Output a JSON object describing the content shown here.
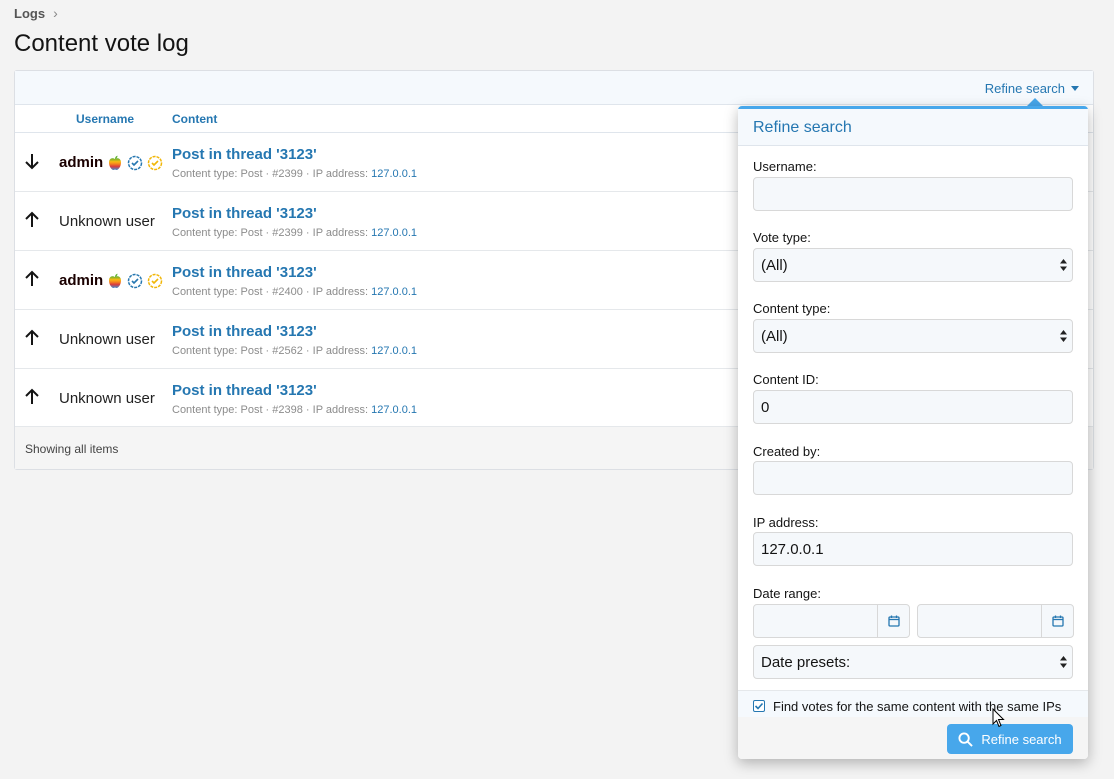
{
  "breadcrumb": {
    "item": "Logs"
  },
  "page": {
    "title": "Content vote log"
  },
  "filterbar": {
    "refine_label": "Refine search"
  },
  "table": {
    "headers": {
      "username": "Username",
      "content": "Content"
    },
    "rows": [
      {
        "vote": "down",
        "username": "admin",
        "user_type": "admin",
        "title": "Post in thread '3123'",
        "meta": "Content type: Post · #2399 · IP address: ",
        "ip": "127.0.0.1"
      },
      {
        "vote": "up",
        "username": "Unknown user",
        "user_type": "unknown",
        "title": "Post in thread '3123'",
        "meta": "Content type: Post · #2399 · IP address: ",
        "ip": "127.0.0.1"
      },
      {
        "vote": "up",
        "username": "admin",
        "user_type": "admin",
        "title": "Post in thread '3123'",
        "meta": "Content type: Post · #2400 · IP address: ",
        "ip": "127.0.0.1"
      },
      {
        "vote": "up",
        "username": "Unknown user",
        "user_type": "unknown",
        "title": "Post in thread '3123'",
        "meta": "Content type: Post · #2562 · IP address: ",
        "ip": "127.0.0.1"
      },
      {
        "vote": "up",
        "username": "Unknown user",
        "user_type": "unknown",
        "title": "Post in thread '3123'",
        "meta": "Content type: Post · #2398 · IP address: ",
        "ip": "127.0.0.1"
      }
    ],
    "footer": "Showing all items"
  },
  "popup": {
    "title": "Refine search",
    "username_label": "Username:",
    "username_value": "",
    "vote_type_label": "Vote type:",
    "vote_type_value": "(All)",
    "content_type_label": "Content type:",
    "content_type_value": "(All)",
    "content_id_label": "Content ID:",
    "content_id_value": "0",
    "created_by_label": "Created by:",
    "created_by_value": "",
    "ip_label": "IP address:",
    "ip_value": "127.0.0.1",
    "date_range_label": "Date range:",
    "date_presets_value": "Date presets:",
    "checkbox_label": "Find votes for the same content with the same IPs",
    "checkbox_checked": true,
    "submit_label": "Refine search"
  },
  "colors": {
    "accent": "#2577b1",
    "button": "#47a7eb",
    "popup_border": "#47a7eb"
  }
}
